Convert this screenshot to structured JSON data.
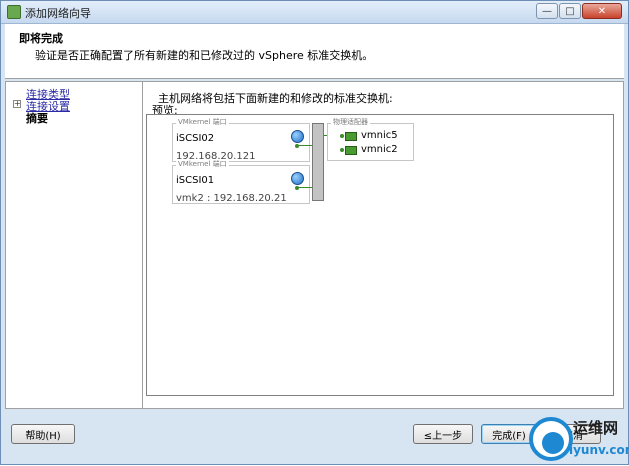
{
  "window": {
    "title": "添加网络向导"
  },
  "header": {
    "title": "即将完成",
    "subtitle": "验证是否正确配置了所有新建的和已修改过的 vSphere 标准交换机。"
  },
  "nav": {
    "items": [
      {
        "label": "连接类型"
      },
      {
        "label": "连接设置"
      },
      {
        "label": "摘要"
      }
    ]
  },
  "main": {
    "description": "主机网络将包括下面新建的和修改的标准交换机:",
    "preview_label": "预览:"
  },
  "diagram": {
    "ports": [
      {
        "legend": "VMkernel 端口",
        "name": "iSCSI02",
        "detail": "192.168.20.121"
      },
      {
        "legend": "VMkernel 端口",
        "name": "iSCSI01",
        "detail": "vmk2 : 192.168.20.21"
      }
    ],
    "adapters_legend": "物理适配器",
    "adapters": [
      {
        "name": "vmnic5"
      },
      {
        "name": "vmnic2"
      }
    ]
  },
  "buttons": {
    "help": "帮助(H)",
    "back": "≤上一步",
    "finish": "完成(F)",
    "cancel": "取消"
  },
  "watermark": {
    "text_cn": "运维网",
    "text_en": "iyunv.com"
  },
  "colors": {
    "link": "#2a2aa6",
    "nic": "#4a9a32",
    "titlebar": "#c6d9ef"
  }
}
